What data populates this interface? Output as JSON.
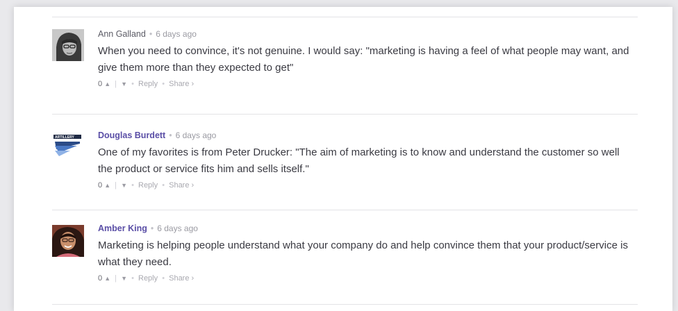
{
  "comments": [
    {
      "author": "Ann Galland",
      "timestamp": "6 days ago",
      "body": "When you need to convince, it's not genuine. I would say: \"marketing is having a feel of what people may want, and give them more than they expected to get\"",
      "votes": "0",
      "reply_label": "Reply",
      "share_label": "Share ›",
      "author_color": "#5c5c66"
    },
    {
      "author": "Douglas Burdett",
      "timestamp": "6 days ago",
      "body": "One of my favorites is from Peter Drucker: \"The aim of marketing is to know and understand the customer so well the product or service fits him and sells itself.\"",
      "votes": "0",
      "reply_label": "Reply",
      "share_label": "Share ›",
      "author_color": "#5a4ea6"
    },
    {
      "author": "Amber King",
      "timestamp": "6 days ago",
      "body": "Marketing is helping people understand what your company do and help convince them that your product/service is what they need.",
      "votes": "0",
      "reply_label": "Reply",
      "share_label": "Share ›",
      "author_color": "#5a4ea6"
    }
  ],
  "icons": {
    "upvote": "chevron-up-icon",
    "downvote": "chevron-down-icon"
  }
}
